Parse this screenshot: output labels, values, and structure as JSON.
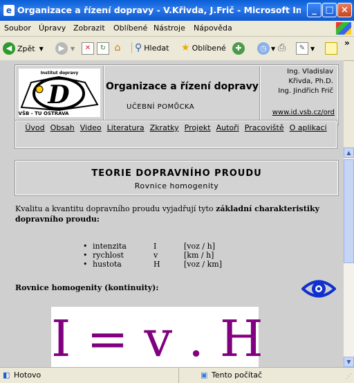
{
  "window": {
    "title": "Organizace a řízení dopravy - V.Křivda, J.Frič - Microsoft Inter...",
    "minimize": "_",
    "maximize": "□",
    "close": "×"
  },
  "menu": [
    "Soubor",
    "Úpravy",
    "Zobrazit",
    "Oblíbené",
    "Nástroje",
    "Nápověda"
  ],
  "toolbar": {
    "back_label": "Zpět",
    "search_label": "Hledat",
    "favorites_label": "Oblíbené",
    "overflow": "»"
  },
  "header": {
    "logo_top": "Institut dopravy",
    "logo_bottom": "VŠB - TU OSTRAVA",
    "title": "Organizace a řízení dopravy",
    "subtitle": "UČEBNÍ POMŮCKA",
    "authors": [
      "Ing. Vladislav",
      "Křivda, Ph.D.",
      "Ing. Jindřich Frič"
    ],
    "url": "www.id.vsb.cz/ord"
  },
  "nav": [
    "Úvod",
    "Obsah",
    "Video",
    "Literatura",
    "Zkratky",
    "Projekt",
    "Autoři",
    "Pracoviště",
    "O aplikaci"
  ],
  "topic": {
    "title": "TEORIE DOPRAVNÍHO PROUDU",
    "subtitle": "Rovnice homogenity"
  },
  "content": {
    "intro": "Kvalitu a kvantitu dopravního proudu vyjadřují tyto",
    "intro_bold": "základní charakteristiky dopravního proudu:",
    "characteristics": [
      {
        "name": "intenzita",
        "symbol": "I",
        "unit": "[voz / h]"
      },
      {
        "name": "rychlost",
        "symbol": "v",
        "unit": "[km / h]"
      },
      {
        "name": "hustota",
        "symbol": "H",
        "unit": "[voz / km]"
      }
    ],
    "homogeneity_heading": "Rovnice homogenity (kontinuity):",
    "formula": "I = v . H"
  },
  "status": {
    "left": "Hotovo",
    "zone": "Tento počítač"
  },
  "colors": {
    "titlebar": "#0a5fd8",
    "formula": "#800080",
    "eye": "#1030d0"
  }
}
